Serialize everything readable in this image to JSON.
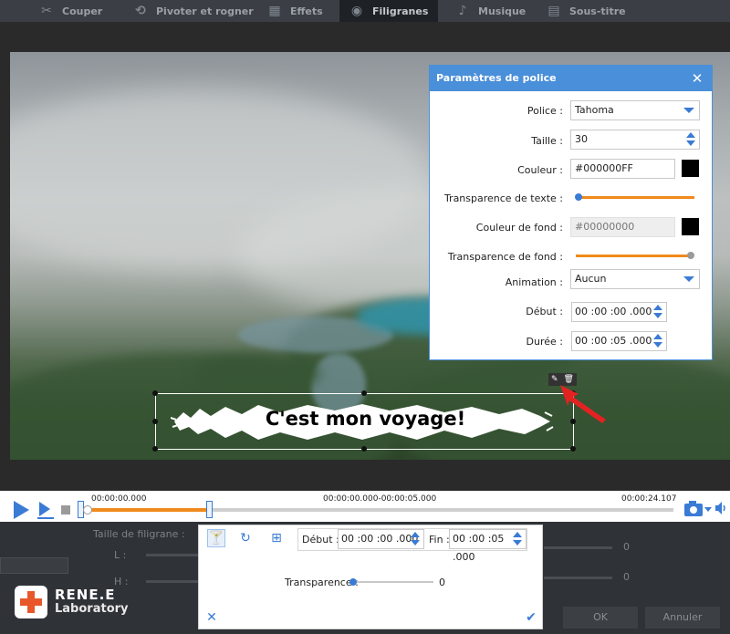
{
  "tabs": [
    {
      "label": "Couper",
      "icon": "cut-icon"
    },
    {
      "label": "Pivoter et rogner",
      "icon": "rotate-crop-icon"
    },
    {
      "label": "Effets",
      "icon": "effects-icon"
    },
    {
      "label": "Filigranes",
      "icon": "watermark-icon",
      "active": true
    },
    {
      "label": "Musique",
      "icon": "music-icon"
    },
    {
      "label": "Sous-titre",
      "icon": "subtitle-icon"
    }
  ],
  "watermark": {
    "text": "C'est mon voyage!"
  },
  "font_dialog": {
    "title": "Paramètres de police",
    "font_label": "Police :",
    "font_value": "Tahoma",
    "size_label": "Taille :",
    "size_value": "30",
    "color_label": "Couleur :",
    "color_value": "#000000FF",
    "text_transparency_label": "Transparence de texte :",
    "text_transparency": 0,
    "bg_color_label": "Couleur de fond :",
    "bg_color_value": "#00000000",
    "bg_transparency_label": "Transparence de fond :",
    "bg_transparency": 1,
    "animation_label": "Animation :",
    "animation_value": "Aucun",
    "start_label": "Début :",
    "start_value": "00 :00 :00 .000",
    "duration_label": "Durée :",
    "duration_value": "00 :00 :05 .000",
    "accent_color": "#4a8fd9",
    "slider_color": "#f08a1c"
  },
  "timeline": {
    "current": "00:00:00.000",
    "range": "00:00:00.000-00:00:05.000",
    "total": "00:00:24.107"
  },
  "background_panel": {
    "size_label": "Taille de filigrane :",
    "l_label": "L :",
    "h_label": "H :",
    "l_value": "0",
    "h_value": "0",
    "ok_label": "OK",
    "cancel_label": "Annuler"
  },
  "watermark_panel": {
    "start_label": "Début :",
    "start_value": "00 :00 :00 .000",
    "end_label": "Fin :",
    "end_value": "00 :00 :05 .000",
    "transparency_label": "Transparence :",
    "transparency_value": "0"
  },
  "logo": {
    "brand": "RENE.E",
    "sub": "Laboratory"
  }
}
